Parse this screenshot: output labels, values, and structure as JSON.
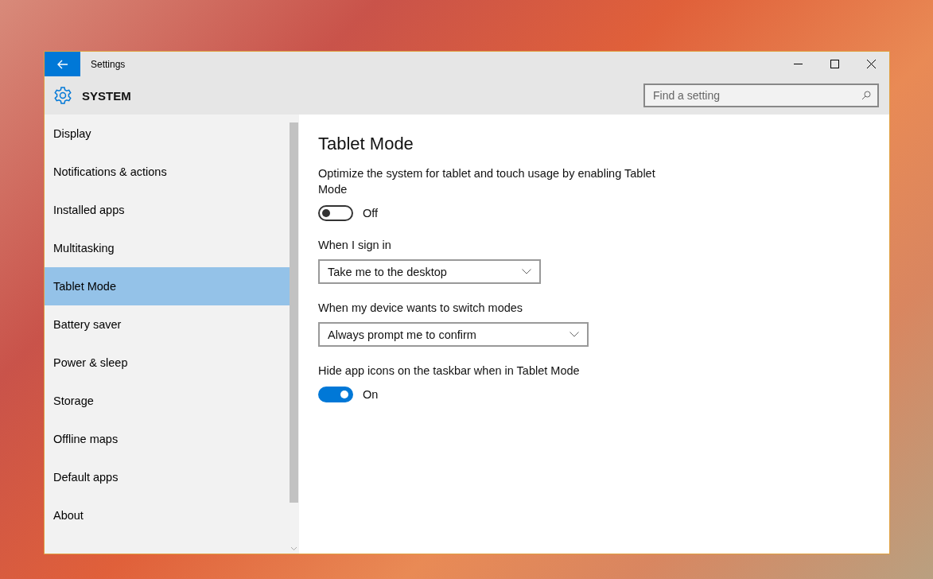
{
  "window": {
    "title": "Settings"
  },
  "header": {
    "title": "SYSTEM",
    "search": {
      "placeholder": "Find a setting"
    }
  },
  "sidebar": {
    "items": [
      {
        "label": "Display",
        "selected": false
      },
      {
        "label": "Notifications & actions",
        "selected": false
      },
      {
        "label": "Installed apps",
        "selected": false
      },
      {
        "label": "Multitasking",
        "selected": false
      },
      {
        "label": "Tablet Mode",
        "selected": true
      },
      {
        "label": "Battery saver",
        "selected": false
      },
      {
        "label": "Power & sleep",
        "selected": false
      },
      {
        "label": "Storage",
        "selected": false
      },
      {
        "label": "Offline maps",
        "selected": false
      },
      {
        "label": "Default apps",
        "selected": false
      },
      {
        "label": "About",
        "selected": false
      }
    ]
  },
  "content": {
    "title": "Tablet Mode",
    "settings": [
      {
        "kind": "toggle",
        "label": "Optimize the system for tablet and touch usage by enabling Tablet Mode",
        "on": false,
        "state_text": "Off"
      },
      {
        "kind": "dropdown",
        "label": "When I sign in",
        "value": "Take me to the desktop"
      },
      {
        "kind": "dropdown",
        "label": "When my device wants to switch modes",
        "value": "Always prompt me to confirm"
      },
      {
        "kind": "toggle",
        "label": "Hide app icons on the taskbar when in Tablet Mode",
        "on": true,
        "state_text": "On"
      }
    ]
  }
}
